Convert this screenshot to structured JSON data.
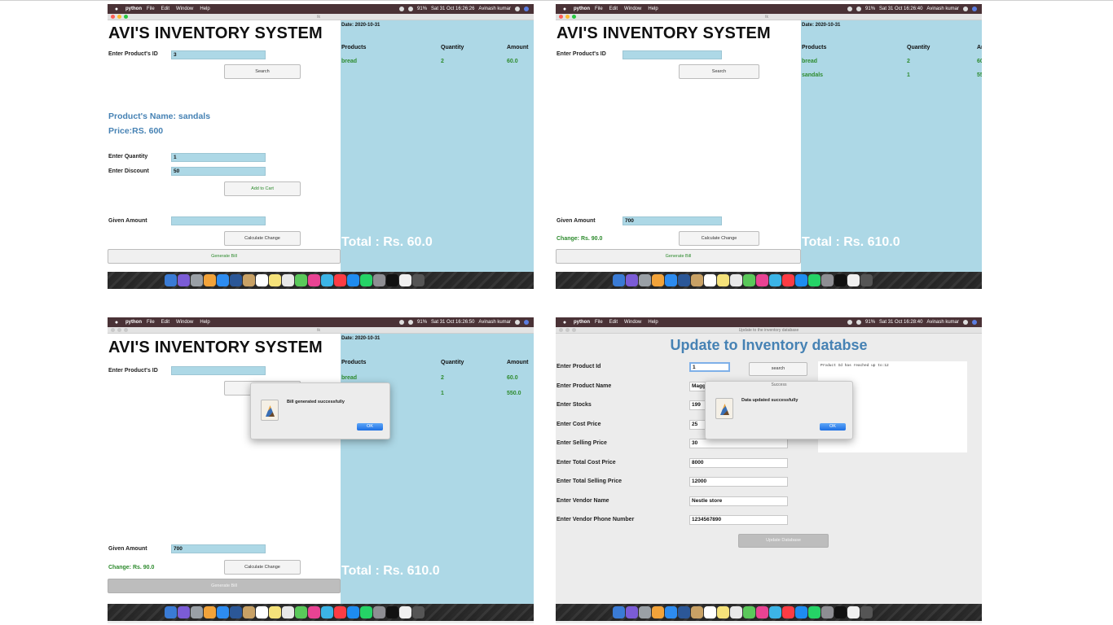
{
  "menubar": {
    "apple": "",
    "app": "python",
    "items": [
      "File",
      "Edit",
      "Window",
      "Help"
    ],
    "battery": "91%",
    "datetimes": [
      "Sat 31 Oct 16:26:26",
      "Sat 31 Oct 16:26:40",
      "Sat 31 Oct 16:26:50",
      "Sat 31 Oct 16:28:40"
    ],
    "user": "Avinash kumar"
  },
  "app": {
    "system_name": "AVI'S INVENTORY SYSTEM",
    "labels": {
      "product_id": "Enter Product's ID",
      "quantity": "Enter Quantity",
      "discount": "Enter Discount",
      "given_amount": "Given Amount"
    },
    "buttons": {
      "search": "Search",
      "add_to_cart": "Add to Cart",
      "calculate_change": "Calculate Change",
      "generate_bill": "Generate Bill"
    }
  },
  "bill": {
    "date": "Date: 2020-10-31",
    "headers": {
      "products": "Products",
      "quantity": "Quantity",
      "amount": "Amount"
    },
    "rows": [
      {
        "product": "bread",
        "quantity": "2",
        "amount": "60.0"
      },
      {
        "product": "sandals",
        "quantity": "1",
        "amount": "550.0"
      }
    ]
  },
  "shot1": {
    "product_id_value": "3",
    "product_name": "Product's Name: sandals",
    "price": "Price:RS. 600",
    "quantity_value": "1",
    "discount_value": "50",
    "given_amount_value": "",
    "total": "Total : Rs. 60.0"
  },
  "shot2": {
    "product_id_value": "",
    "given_amount_value": "700",
    "change": "Change: Rs. 90.0",
    "total": "Total : Rs. 610.0"
  },
  "shot3": {
    "product_id_value": "",
    "given_amount_value": "700",
    "change": "Change: Rs. 90.0",
    "total": "Total : Rs. 610.0",
    "dialog_message": "Bill generated successfully",
    "dialog_ok": "OK"
  },
  "shot4": {
    "window_title": "Update to the inventory database",
    "title": "Update to Inventory databse",
    "search_button": "search",
    "update_button": "Update Database",
    "notes_text": "Product Id has reached up to:12",
    "fields": [
      {
        "label": "Enter Product Id",
        "value": "1"
      },
      {
        "label": "Enter Product Name",
        "value": "Magg"
      },
      {
        "label": "Enter Stocks",
        "value": "199"
      },
      {
        "label": "Enter Cost Price",
        "value": "25"
      },
      {
        "label": "Enter Selling Price",
        "value": "30"
      },
      {
        "label": "Enter Total Cost Price",
        "value": "8000"
      },
      {
        "label": "Enter Total Selling Price",
        "value": "12000"
      },
      {
        "label": "Enter Vendor Name",
        "value": "Nestle store"
      },
      {
        "label": "Enter Vendor Phone Number",
        "value": "1234567890"
      }
    ],
    "dialog_title": "Success",
    "dialog_message": "Data updated successfully",
    "dialog_ok": "OK"
  },
  "colors": {
    "input_bg": "#add8e6",
    "bill_bg": "#add8e6",
    "green_text": "#2e8b2e",
    "blue_title": "#4682b4"
  }
}
